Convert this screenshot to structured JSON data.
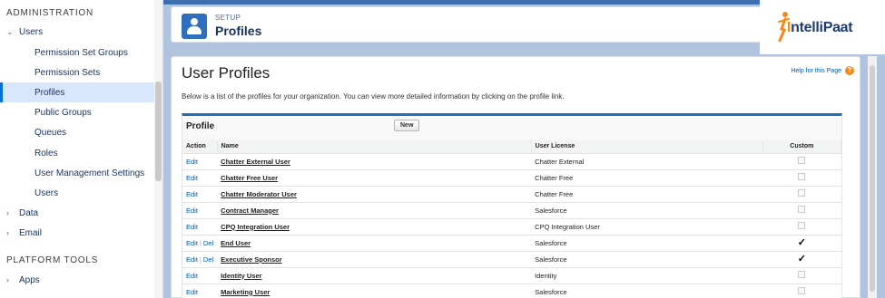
{
  "sidebar": {
    "section_admin": "ADMINISTRATION",
    "users_group": {
      "chevron": "chevron-down-icon",
      "label": "Users"
    },
    "user_items": [
      {
        "label": "Permission Set Groups"
      },
      {
        "label": "Permission Sets"
      },
      {
        "label": "Profiles"
      },
      {
        "label": "Public Groups"
      },
      {
        "label": "Queues"
      },
      {
        "label": "Roles"
      },
      {
        "label": "User Management Settings"
      },
      {
        "label": "Users"
      }
    ],
    "data_group": {
      "chevron": "chevron-right-icon",
      "label": "Data"
    },
    "email_group": {
      "chevron": "chevron-right-icon",
      "label": "Email"
    },
    "section_platform": "PLATFORM TOOLS",
    "apps_group": {
      "chevron": "chevron-right-icon",
      "label": "Apps"
    }
  },
  "header": {
    "eyebrow": "SETUP",
    "title": "Profiles",
    "icon": "user-profile-icon"
  },
  "logo": {
    "prefix": "I",
    "text": "ntelliPaat"
  },
  "content": {
    "page_title": "User Profiles",
    "help_link": "Help for this Page",
    "description": "Below is a list of the profiles for your organization. You can view more detailed information by clicking on the profile link.",
    "panel_title": "Profile",
    "new_button": "New"
  },
  "table": {
    "headers": {
      "action": "Action",
      "name": "Name",
      "license": "User License",
      "custom": "Custom"
    },
    "edit_label": "Edit",
    "del_label": "Del",
    "separator": "|",
    "check_mark": "✓",
    "rows": [
      {
        "name": "Chatter External User",
        "license": "Chatter External",
        "custom": false,
        "del": false
      },
      {
        "name": "Chatter Free User",
        "license": "Chatter Free",
        "custom": false,
        "del": false
      },
      {
        "name": "Chatter Moderator User",
        "license": "Chatter Free",
        "custom": false,
        "del": false
      },
      {
        "name": "Contract Manager",
        "license": "Salesforce",
        "custom": false,
        "del": false
      },
      {
        "name": "CPQ Integration User",
        "license": "CPQ Integration User",
        "custom": false,
        "del": false
      },
      {
        "name": "End User",
        "license": "Salesforce",
        "custom": true,
        "del": true
      },
      {
        "name": "Executive Sponsor",
        "license": "Salesforce",
        "custom": true,
        "del": true
      },
      {
        "name": "Identity User",
        "license": "Identity",
        "custom": false,
        "del": false
      },
      {
        "name": "Marketing User",
        "license": "Salesforce",
        "custom": false,
        "del": false
      }
    ]
  },
  "colors": {
    "accent": "#0070d2",
    "header_icon": "#2f6fbd",
    "frame": "#b0c4df",
    "brand_orange": "#f08a1c",
    "brand_blue": "#1f3b73"
  }
}
